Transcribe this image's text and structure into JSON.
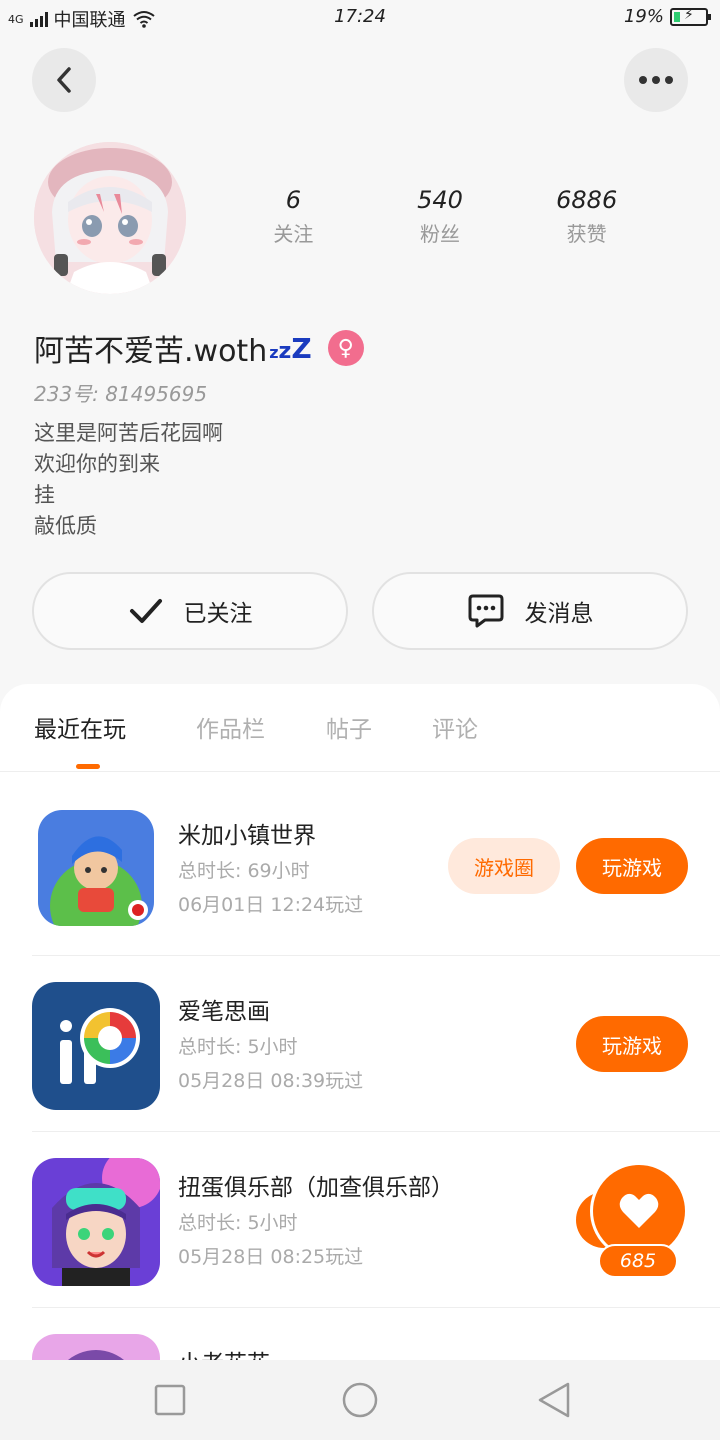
{
  "status_bar": {
    "network": "4G",
    "carrier": "中国联通",
    "time": "17:24",
    "battery": "19%",
    "battery_level": 0.19
  },
  "profile": {
    "name": "阿苦不爱苦.woth",
    "name_suffix": {
      "z1": "z",
      "z2": "z",
      "z3": "Z"
    },
    "gender_icon": "female-symbol-icon",
    "uid": "233号: 81495695",
    "bio": [
      "这里是阿苦后花园啊",
      "欢迎你的到来",
      "挂",
      "敲低质"
    ],
    "stats": [
      {
        "value": "6",
        "label": "关注"
      },
      {
        "value": "540",
        "label": "粉丝"
      },
      {
        "value": "6886",
        "label": "获赞"
      }
    ]
  },
  "actions": {
    "follow_label": "已关注",
    "message_label": "发消息"
  },
  "tabs": [
    {
      "label": "最近在玩",
      "active": true
    },
    {
      "label": "作品栏",
      "active": false
    },
    {
      "label": "帖子",
      "active": false
    },
    {
      "label": "评论",
      "active": false
    }
  ],
  "games": [
    {
      "name": "米加小镇世界",
      "duration": "总时长: 69小时",
      "last_played": "06月01日 12:24玩过",
      "circle_label": "游戏圈",
      "play_label": "玩游戏"
    },
    {
      "name": "爱笔思画",
      "duration": "总时长: 5小时",
      "last_played": "05月28日 08:39玩过",
      "play_label": "玩游戏"
    },
    {
      "name": "扭蛋俱乐部（加查俱乐部）",
      "duration": "总时长: 5小时",
      "last_played": "05月28日 08:25玩过"
    },
    {
      "name": "小老花花"
    }
  ],
  "like_widget": {
    "count": "685",
    "icon": "heart-icon"
  },
  "colors": {
    "accent": "#ff6a00",
    "accent_light": "#ffe9dc",
    "gender": "#f26d8e"
  }
}
